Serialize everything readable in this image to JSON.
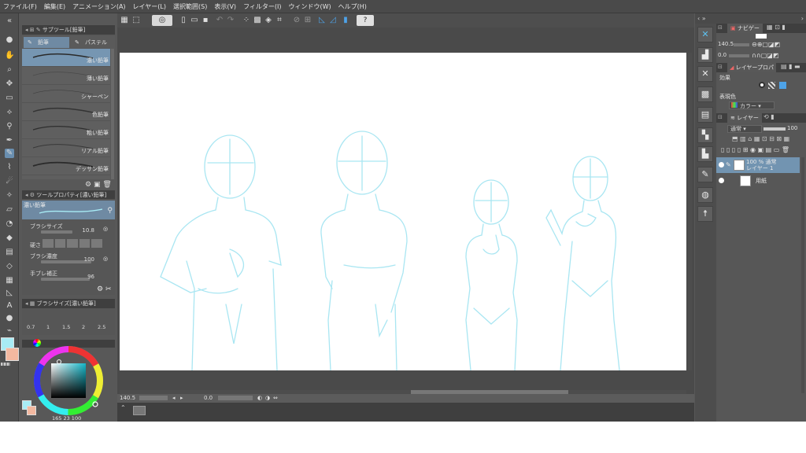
{
  "menu": [
    "ファイル(F)",
    "編集(E)",
    "アニメーション(A)",
    "レイヤー(L)",
    "選択範囲(S)",
    "表示(V)",
    "フィルター(I)",
    "ウィンドウ(W)",
    "ヘルプ(H)"
  ],
  "subtool": {
    "header": "サブツール[鉛筆]",
    "tabs": [
      "鉛筆",
      "パステル"
    ],
    "brushes": [
      "濃い鉛筆",
      "薄い鉛筆",
      "シャーペン",
      "色鉛筆",
      "粗い鉛筆",
      "リアル鉛筆",
      "デッサン鉛筆"
    ]
  },
  "toolprop": {
    "header": "ツールプロパティ[濃い鉛筆]",
    "preset_name": "濃い鉛筆",
    "brush_size_label": "ブラシサイズ",
    "brush_size_value": "10.8",
    "hardness_label": "硬さ",
    "density_label": "ブラシ濃度",
    "density_value": "100",
    "stabilization_label": "手ブレ補正",
    "stabilization_value": "96"
  },
  "brushsize_panel": {
    "header": "ブラシサイズ[濃い鉛筆]",
    "ticks": [
      "0.7",
      "1",
      "1.5",
      "2",
      "2.5"
    ]
  },
  "color_readout": "165  23  100",
  "status": {
    "zoom": "140.5",
    "angle": "0.0"
  },
  "navigator": {
    "tab": "ナビゲー",
    "zoom": "140.5",
    "angle": "0.0"
  },
  "layer_property": {
    "tab": "レイヤープロパ",
    "effect_label": "効果",
    "expression_label": "表現色",
    "expression_value": "カラー"
  },
  "layers": {
    "tab": "レイヤー",
    "blend_mode": "通常",
    "opacity": "100",
    "items": [
      {
        "line1": "100 % 通常",
        "line2": "レイヤー 1"
      },
      {
        "line1": "",
        "line2": "用紙"
      }
    ]
  },
  "colors": {
    "main_color": "#a8ecf5",
    "sub_color": "#f3b8a0",
    "sketch": "#a9e6f2"
  }
}
